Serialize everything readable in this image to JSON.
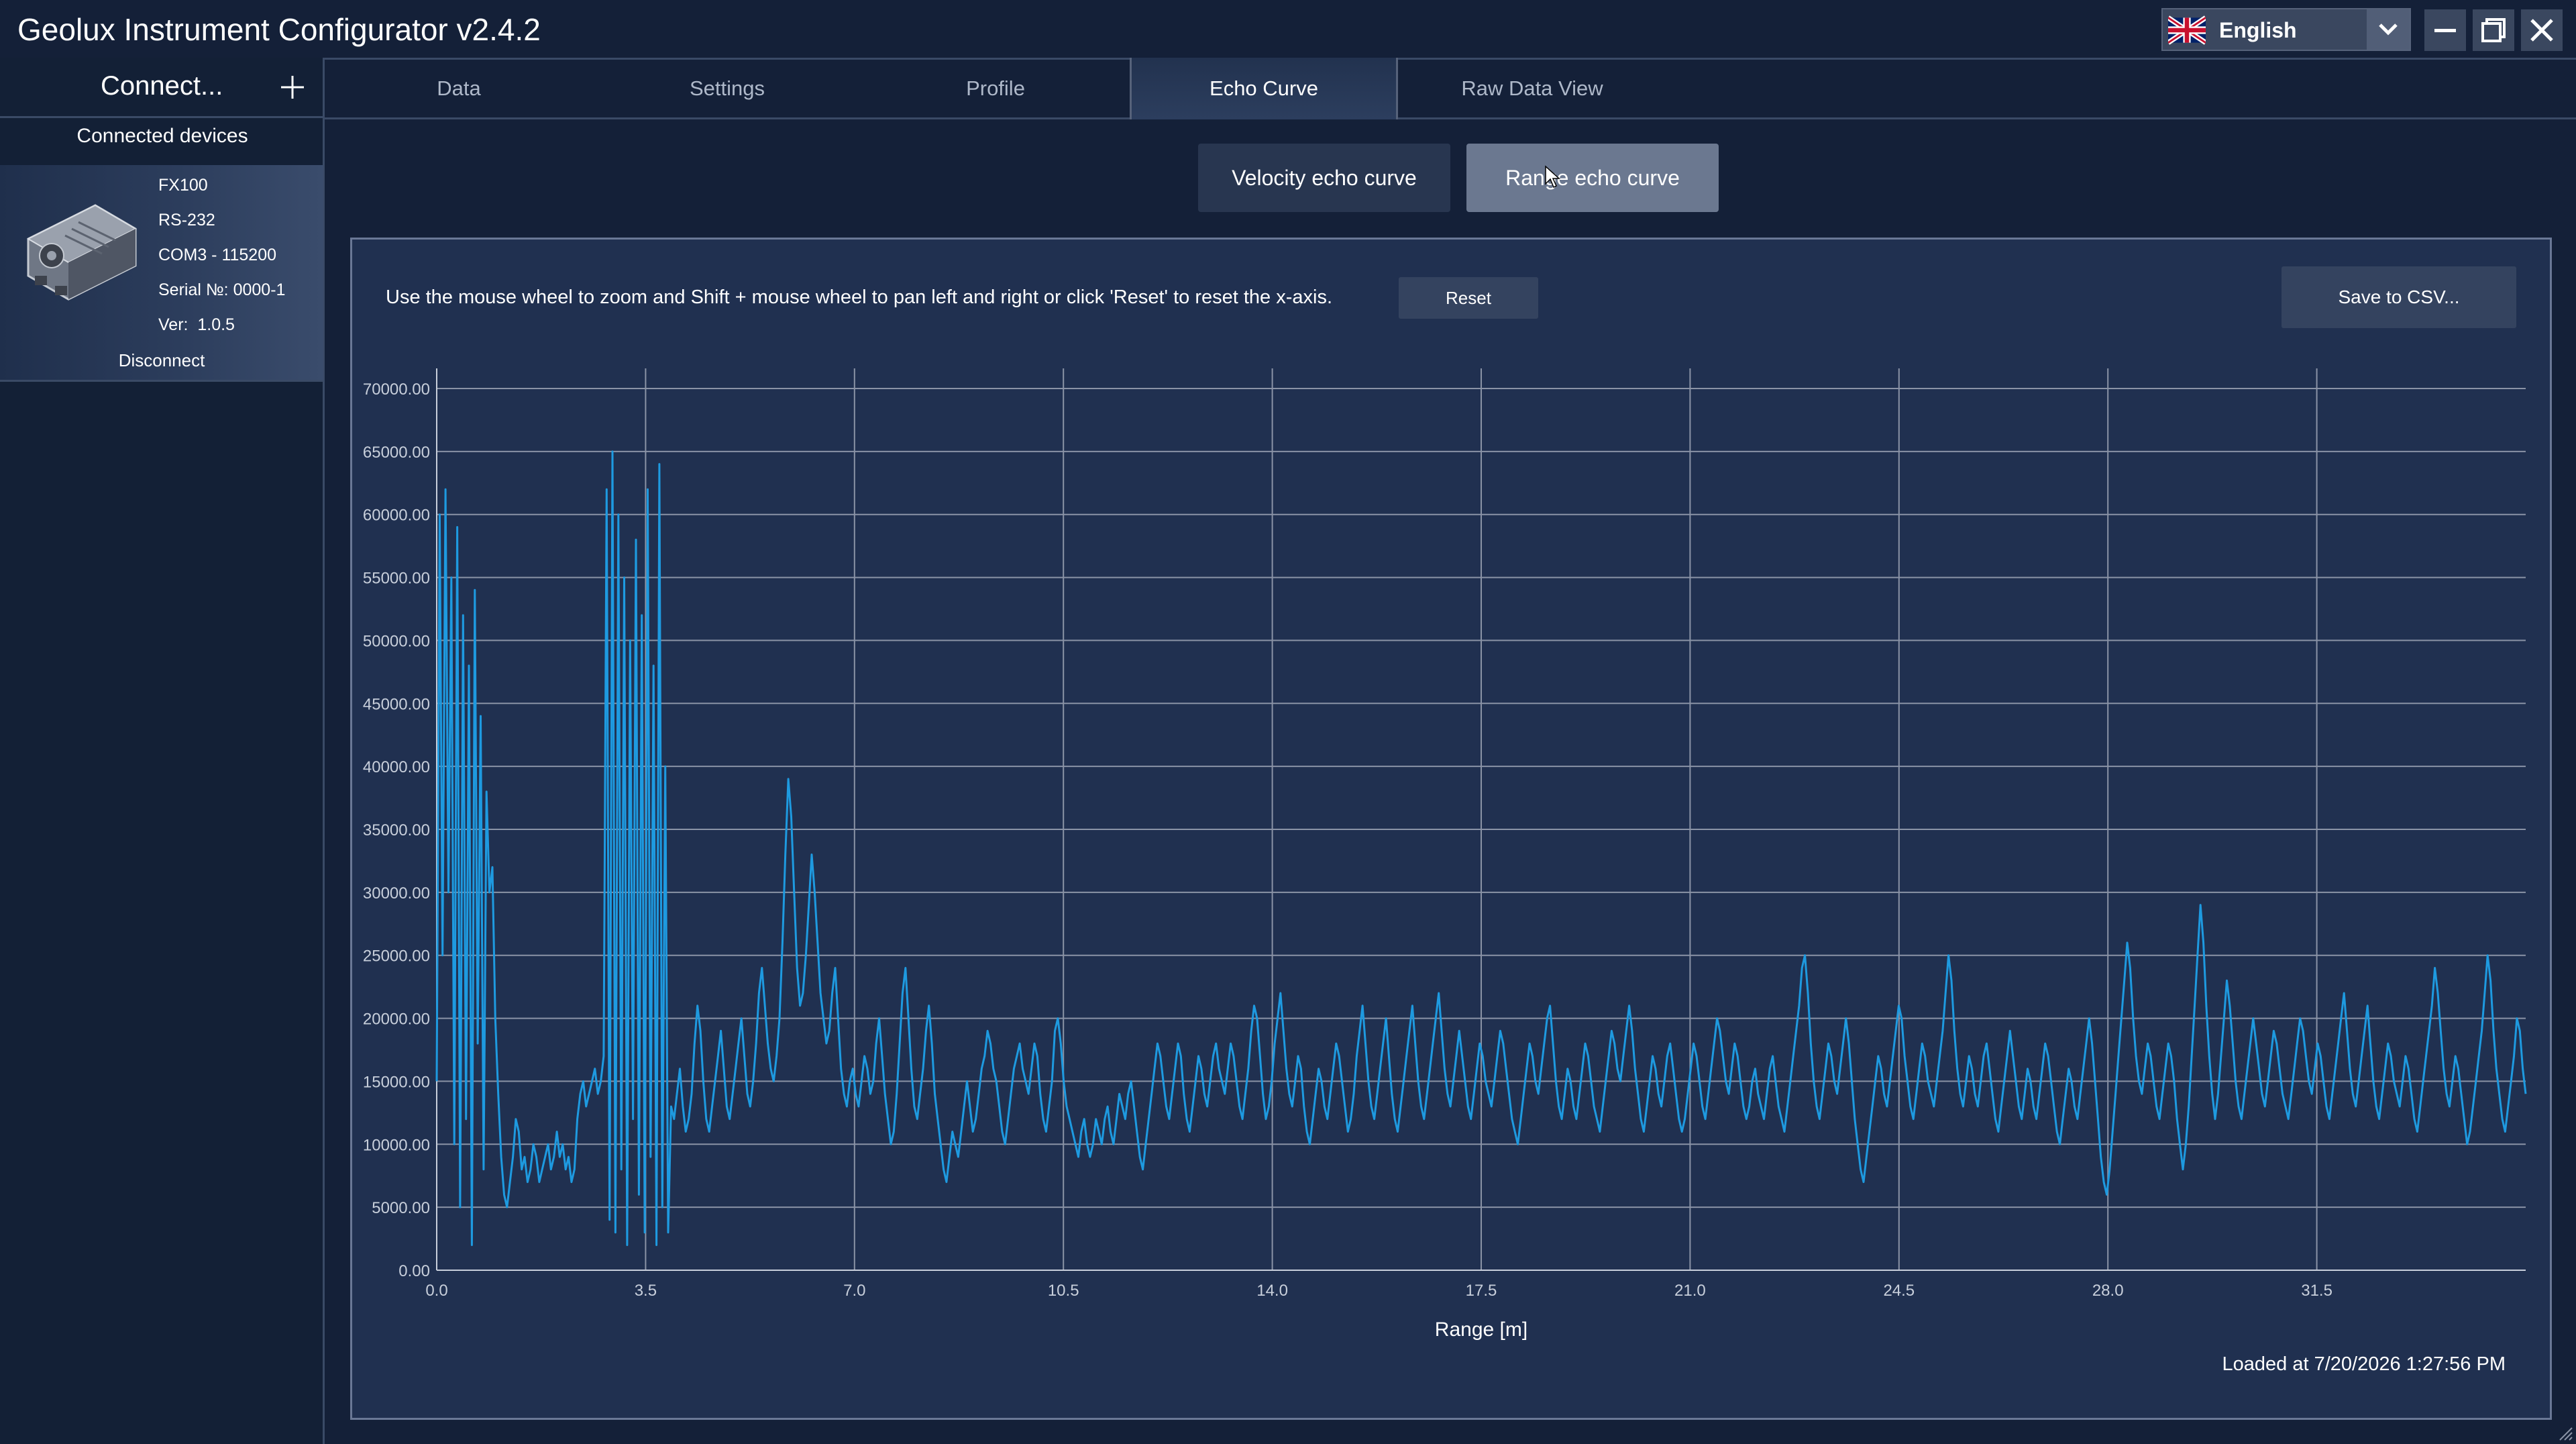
{
  "app": {
    "title": "Geolux Instrument Configurator v2.4.2"
  },
  "language": {
    "selected": "English",
    "flag": "uk-flag-icon"
  },
  "window_controls": {
    "minimize": "minimize-icon",
    "maximize": "restore-icon",
    "close": "close-icon"
  },
  "sidebar": {
    "connect_label": "Connect...",
    "devices_header": "Connected devices",
    "device": {
      "model": "FX100",
      "interface": "RS-232",
      "port": "COM3 - 115200",
      "serial": "Serial №: 0000-1",
      "version": "Ver:  1.0.5",
      "disconnect_label": "Disconnect"
    }
  },
  "tabs": [
    {
      "label": "Data"
    },
    {
      "label": "Settings"
    },
    {
      "label": "Profile"
    },
    {
      "label": "Echo Curve",
      "active": true
    },
    {
      "label": "Raw Data View"
    }
  ],
  "curve_buttons": {
    "velocity": "Velocity echo curve",
    "range": "Range echo curve",
    "selected": "range"
  },
  "panel": {
    "instructions": "Use the mouse wheel to zoom and Shift + mouse wheel to pan left and right or click 'Reset' to reset the x-axis.",
    "reset_label": "Reset",
    "csv_label": "Save to CSV...",
    "loaded_at": "Loaded at 7/20/2026 1:27:56 PM"
  },
  "colors": {
    "background": "#142038",
    "panel": "#203050",
    "line": "#1e9ae0",
    "grid": "#8a93a6"
  },
  "chart_data": {
    "type": "line",
    "xlabel": "Range [m]",
    "ylabel": "",
    "xlim": [
      0,
      35
    ],
    "ylim": [
      0,
      70000
    ],
    "x_ticks": [
      "0.0",
      "3.5",
      "7.0",
      "10.5",
      "14.0",
      "17.5",
      "21.0",
      "24.5",
      "28.0",
      "31.5"
    ],
    "y_ticks": [
      "0.00",
      "5000.00",
      "10000.00",
      "15000.00",
      "20000.00",
      "25000.00",
      "30000.00",
      "35000.00",
      "40000.00",
      "45000.00",
      "50000.00",
      "55000.00",
      "60000.00",
      "65000.00",
      "70000.00"
    ],
    "grid": true,
    "x_step": 0.035,
    "values": [
      15000,
      60000,
      25000,
      62000,
      30000,
      55000,
      10000,
      59000,
      5000,
      52000,
      12000,
      48000,
      2000,
      54000,
      18000,
      44000,
      8000,
      38000,
      30000,
      32000,
      20000,
      14000,
      9000,
      6000,
      5000,
      7000,
      9000,
      12000,
      11000,
      8000,
      9000,
      7000,
      8000,
      10000,
      9000,
      7000,
      8000,
      9000,
      10000,
      8000,
      9000,
      11000,
      9000,
      10000,
      8000,
      9000,
      7000,
      8000,
      12000,
      14000,
      15000,
      13000,
      14000,
      15000,
      16000,
      14000,
      15000,
      17000,
      62000,
      4000,
      65000,
      3000,
      60000,
      8000,
      55000,
      2000,
      50000,
      12000,
      58000,
      6000,
      52000,
      3000,
      62000,
      9000,
      48000,
      2000,
      64000,
      5000,
      40000,
      3000,
      13000,
      12000,
      14000,
      16000,
      13000,
      11000,
      12000,
      14000,
      18000,
      21000,
      19000,
      15000,
      12000,
      11000,
      13000,
      15000,
      17000,
      19000,
      16000,
      13000,
      12000,
      14000,
      16000,
      18000,
      20000,
      17000,
      14000,
      13000,
      15000,
      18000,
      22000,
      24000,
      21000,
      18000,
      16000,
      15000,
      17000,
      20000,
      26000,
      33000,
      39000,
      36000,
      30000,
      24000,
      21000,
      22000,
      25000,
      29000,
      33000,
      30000,
      26000,
      22000,
      20000,
      18000,
      19000,
      22000,
      24000,
      20000,
      16000,
      14000,
      13000,
      15000,
      16000,
      14000,
      13000,
      15000,
      17000,
      16000,
      14000,
      15000,
      18000,
      20000,
      17000,
      14000,
      12000,
      10000,
      11000,
      14000,
      18000,
      22000,
      24000,
      20000,
      16000,
      13000,
      12000,
      14000,
      16000,
      19000,
      21000,
      18000,
      14000,
      12000,
      10000,
      8000,
      7000,
      9000,
      11000,
      10000,
      9000,
      11000,
      13000,
      15000,
      13000,
      11000,
      12000,
      14000,
      16000,
      17000,
      19000,
      18000,
      16000,
      15000,
      13000,
      11000,
      10000,
      12000,
      14000,
      16000,
      17000,
      18000,
      16000,
      15000,
      14000,
      16000,
      18000,
      17000,
      14000,
      12000,
      11000,
      13000,
      15000,
      19000,
      20000,
      18000,
      15000,
      13000,
      12000,
      11000,
      10000,
      9000,
      11000,
      12000,
      10000,
      9000,
      10000,
      12000,
      11000,
      10000,
      12000,
      13000,
      11000,
      10000,
      12000,
      14000,
      13000,
      12000,
      14000,
      15000,
      13000,
      11000,
      9000,
      8000,
      10000,
      12000,
      14000,
      16000,
      18000,
      17000,
      15000,
      13000,
      12000,
      14000,
      16000,
      18000,
      17000,
      14000,
      12000,
      11000,
      13000,
      15000,
      17000,
      16000,
      14000,
      13000,
      15000,
      17000,
      18000,
      16000,
      15000,
      14000,
      16000,
      18000,
      17000,
      15000,
      13000,
      12000,
      14000,
      16000,
      19000,
      21000,
      20000,
      17000,
      14000,
      12000,
      13000,
      15000,
      18000,
      20000,
      22000,
      19000,
      16000,
      14000,
      13000,
      15000,
      17000,
      16000,
      13000,
      11000,
      10000,
      12000,
      14000,
      16000,
      15000,
      13000,
      12000,
      14000,
      16000,
      18000,
      17000,
      15000,
      13000,
      11000,
      12000,
      14000,
      17000,
      19000,
      21000,
      18000,
      15000,
      13000,
      12000,
      14000,
      16000,
      18000,
      20000,
      17000,
      14000,
      12000,
      11000,
      13000,
      15000,
      17000,
      19000,
      21000,
      18000,
      15000,
      13000,
      12000,
      14000,
      16000,
      18000,
      20000,
      22000,
      19000,
      16000,
      14000,
      13000,
      15000,
      17000,
      19000,
      17000,
      15000,
      13000,
      12000,
      14000,
      16000,
      18000,
      17000,
      15000,
      14000,
      13000,
      15000,
      17000,
      19000,
      18000,
      16000,
      14000,
      12000,
      11000,
      10000,
      12000,
      14000,
      16000,
      18000,
      17000,
      15000,
      14000,
      16000,
      18000,
      20000,
      21000,
      18000,
      15000,
      13000,
      12000,
      14000,
      16000,
      15000,
      13000,
      12000,
      14000,
      16000,
      18000,
      17000,
      15000,
      13000,
      12000,
      11000,
      13000,
      15000,
      17000,
      19000,
      18000,
      16000,
      15000,
      17000,
      19000,
      21000,
      19000,
      16000,
      14000,
      12000,
      11000,
      13000,
      15000,
      17000,
      16000,
      14000,
      13000,
      15000,
      17000,
      18000,
      16000,
      14000,
      12000,
      11000,
      12000,
      14000,
      16000,
      18000,
      17000,
      15000,
      13000,
      12000,
      14000,
      16000,
      18000,
      20000,
      19000,
      17000,
      15000,
      14000,
      16000,
      18000,
      17000,
      15000,
      13000,
      12000,
      13000,
      15000,
      16000,
      14000,
      13000,
      12000,
      14000,
      16000,
      17000,
      15000,
      13000,
      12000,
      11000,
      13000,
      15000,
      17000,
      19000,
      21000,
      24000,
      25000,
      22000,
      18000,
      15000,
      13000,
      12000,
      14000,
      16000,
      18000,
      17000,
      15000,
      14000,
      16000,
      18000,
      20000,
      18000,
      15000,
      12000,
      10000,
      8000,
      7000,
      9000,
      11000,
      13000,
      15000,
      17000,
      16000,
      14000,
      13000,
      15000,
      17000,
      19000,
      21000,
      20000,
      17000,
      15000,
      13000,
      12000,
      14000,
      16000,
      18000,
      17000,
      15000,
      14000,
      13000,
      15000,
      17000,
      19000,
      22000,
      25000,
      23000,
      19000,
      16000,
      14000,
      13000,
      15000,
      17000,
      16000,
      14000,
      13000,
      15000,
      17000,
      18000,
      16000,
      14000,
      12000,
      11000,
      13000,
      15000,
      17000,
      19000,
      17000,
      15000,
      13000,
      12000,
      14000,
      16000,
      15000,
      13000,
      12000,
      14000,
      16000,
      18000,
      17000,
      15000,
      13000,
      11000,
      10000,
      12000,
      14000,
      16000,
      15000,
      13000,
      12000,
      14000,
      16000,
      18000,
      20000,
      18000,
      15000,
      12000,
      9000,
      7000,
      6000,
      8000,
      11000,
      14000,
      17000,
      20000,
      23000,
      26000,
      24000,
      20000,
      17000,
      15000,
      14000,
      16000,
      18000,
      17000,
      15000,
      13000,
      12000,
      14000,
      16000,
      18000,
      17000,
      15000,
      12000,
      10000,
      8000,
      10000,
      13000,
      17000,
      21000,
      25000,
      29000,
      26000,
      21000,
      17000,
      14000,
      12000,
      14000,
      17000,
      20000,
      23000,
      21000,
      18000,
      15000,
      13000,
      12000,
      14000,
      16000,
      18000,
      20000,
      18000,
      16000,
      14000,
      13000,
      15000,
      17000,
      19000,
      18000,
      16000,
      14000,
      13000,
      12000,
      14000,
      16000,
      18000,
      20000,
      19000,
      17000,
      15000,
      14000,
      16000,
      18000,
      17000,
      15000,
      13000,
      12000,
      14000,
      16000,
      18000,
      20000,
      22000,
      19000,
      16000,
      14000,
      13000,
      15000,
      17000,
      19000,
      21000,
      18000,
      15000,
      13000,
      12000,
      14000,
      16000,
      18000,
      17000,
      15000,
      14000,
      13000,
      15000,
      17000,
      16000,
      14000,
      12000,
      11000,
      13000,
      15000,
      17000,
      19000,
      21000,
      24000,
      22000,
      19000,
      16000,
      14000,
      13000,
      15000,
      17000,
      16000,
      14000,
      12000,
      10000,
      11000,
      13000,
      15000,
      17000,
      19000,
      22000,
      25000,
      23000,
      19000,
      16000,
      14000,
      12000,
      11000,
      13000,
      15000,
      17000,
      20000,
      19000,
      16000,
      14000
    ]
  }
}
